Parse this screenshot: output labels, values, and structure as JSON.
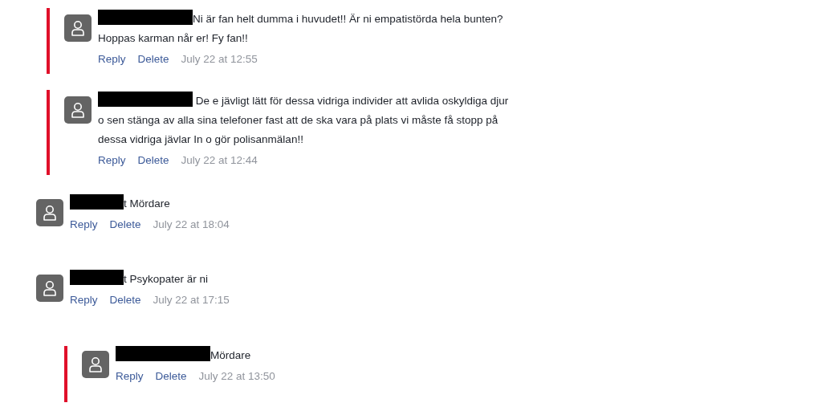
{
  "comments": [
    {
      "kind": "reply",
      "redacted": true,
      "text": "Ni är fan helt dumma i huvudet!! Är ni empatistörda hela bunten? Hoppas karman når er! Fy fan!!",
      "actions": [
        "Reply",
        "Delete"
      ],
      "time": "July 22 at 12:55"
    },
    {
      "kind": "reply",
      "redacted": true,
      "text": " De e jävligt lätt för dessa vidriga individer att avlida oskyldiga djur o sen stänga av alla sina telefoner fast att de ska vara på plats  vi måste få stopp på dessa vidriga jävlar  In o gör polisanmälan!!",
      "actions": [
        "Reply",
        "Delete"
      ],
      "time": "July 22 at 12:44"
    },
    {
      "kind": "comment",
      "redacted": true,
      "text": "t Mördare",
      "actions": [
        "Reply",
        "Delete"
      ],
      "time": "July 22 at 18:04"
    },
    {
      "kind": "comment",
      "redacted": true,
      "text": "t Psykopater är ni",
      "actions": [
        "Reply",
        "Delete"
      ],
      "time": "July 22 at 17:15",
      "children": [
        {
          "kind": "reply",
          "redacted": true,
          "text": "Mördare",
          "actions": [
            "Reply",
            "Delete"
          ],
          "time": "July 22 at 13:50"
        }
      ]
    }
  ]
}
